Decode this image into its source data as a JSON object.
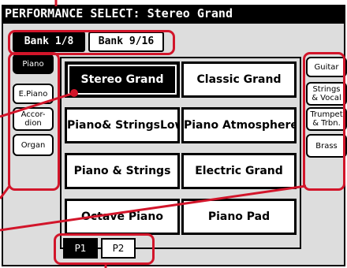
{
  "title": "PERFORMANCE SELECT: Stereo Grand",
  "bank_tabs": [
    {
      "label": "Bank 1/8",
      "selected": true
    },
    {
      "label": "Bank 9/16",
      "selected": false
    }
  ],
  "left_categories": [
    {
      "label": "Piano",
      "selected": true
    },
    {
      "label": "E.Piano",
      "selected": false
    },
    {
      "label": "Accor-\ndion",
      "selected": false
    },
    {
      "label": "Organ",
      "selected": false
    }
  ],
  "right_categories": [
    {
      "label": "Guitar",
      "selected": false
    },
    {
      "label": "Strings\n& Vocal",
      "selected": false
    },
    {
      "label": "Trumpet\n& Trbn.",
      "selected": false
    },
    {
      "label": "Brass",
      "selected": false
    }
  ],
  "sounds": [
    {
      "label": "Stereo Grand",
      "selected": true
    },
    {
      "label": "Classic Grand",
      "selected": false
    },
    {
      "label": "Piano& StringsLow",
      "selected": false
    },
    {
      "label": "Piano Atmosphere",
      "selected": false
    },
    {
      "label": "Piano & Strings",
      "selected": false
    },
    {
      "label": "Electric Grand",
      "selected": false
    },
    {
      "label": "Octave Piano",
      "selected": false
    },
    {
      "label": "Piano Pad",
      "selected": false
    }
  ],
  "page_tabs": [
    {
      "label": "P1",
      "selected": true
    },
    {
      "label": "P2",
      "selected": false
    }
  ],
  "colors": {
    "highlight": "#d2152a",
    "screen_background": "#dddddd",
    "selected": "#000000"
  }
}
